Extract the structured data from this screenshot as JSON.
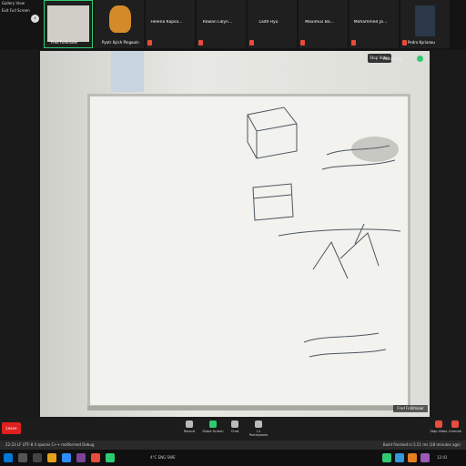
{
  "gallery": {
    "view_label": "Gallery View",
    "exit_label": "Exit Full Screen"
  },
  "participants": [
    {
      "name": "Fred Fohlmaier",
      "position": 0,
      "has_video": true,
      "active": true,
      "muted": false
    },
    {
      "name": "Pyotr Ilyich Pingouin",
      "position": 1,
      "has_video": true,
      "active": false,
      "muted": false
    },
    {
      "name": "Helena Kapsa...",
      "position": 2,
      "has_video": false,
      "active": false,
      "muted": true
    },
    {
      "name": "Rowan Likyn...",
      "position": 3,
      "has_video": false,
      "active": false,
      "muted": true
    },
    {
      "name": "Laith Ryu",
      "position": 4,
      "has_video": false,
      "active": false,
      "muted": true
    },
    {
      "name": "Maximus Bo...",
      "position": 5,
      "has_video": false,
      "active": false,
      "muted": true
    },
    {
      "name": "Mohammed Ja...",
      "position": 6,
      "has_video": false,
      "active": false,
      "muted": true
    },
    {
      "name": "Pedro Kyrianou",
      "position": 7,
      "has_video": true,
      "active": false,
      "muted": true
    }
  ],
  "stage": {
    "recording_label": "Recording",
    "stop_video_label": "Stop Video",
    "self_name": "Fred Fohlmaier"
  },
  "toolbar": {
    "leave_label": "Leave",
    "record_label": "Record",
    "share_label": "Share Screen",
    "chat_label": "Chat",
    "participants_label": "Participants",
    "participants_count": "11",
    "stop_video_label": "Stop Video",
    "mute_label": "Unmute"
  },
  "statusbar": {
    "left": "22:23 LF UTF-8 4 spaces C++ malformed Debug",
    "right": "Build finished in 5.51 ms (18 minutes ago)"
  },
  "taskbar": {
    "tray_text": "4°C  ENG  SWE",
    "time": "12:01"
  }
}
